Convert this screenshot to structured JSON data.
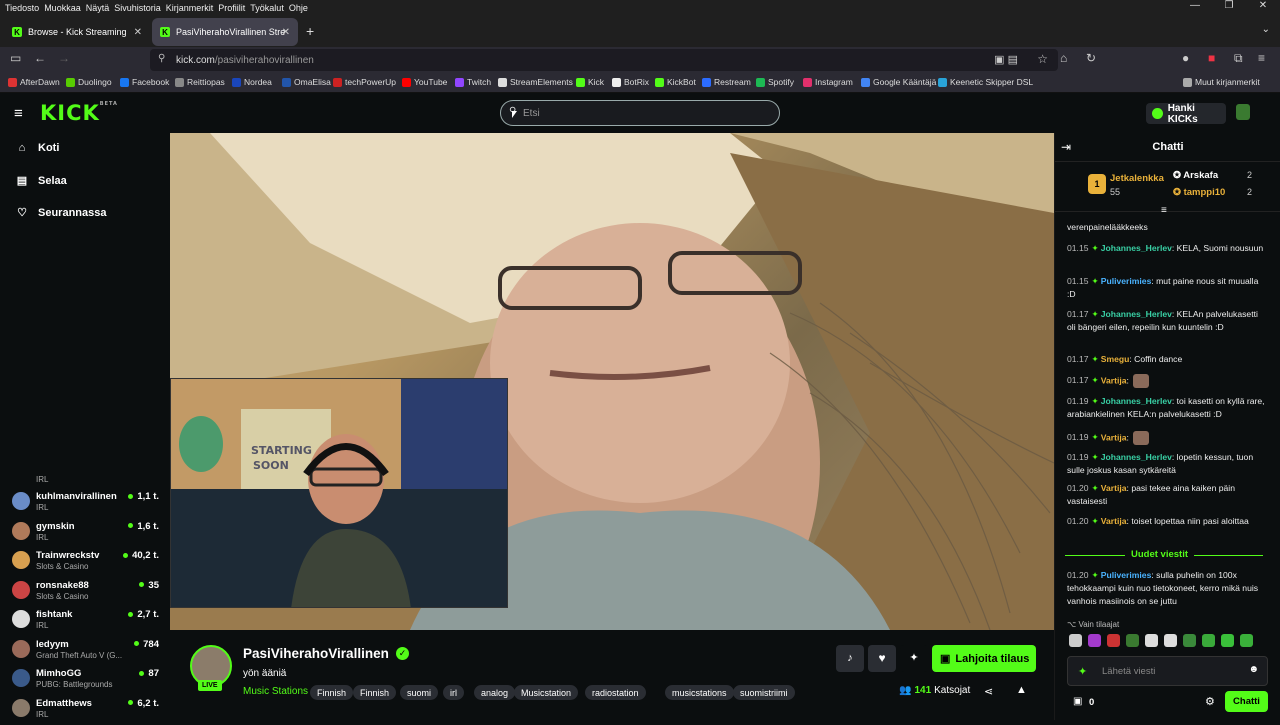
{
  "menubar": {
    "items": [
      "Tiedosto",
      "Muokkaa",
      "Näytä",
      "Sivuhistoria",
      "Kirjanmerkit",
      "Profiilit",
      "Työkalut",
      "Ohje"
    ]
  },
  "tabs": [
    {
      "label": "Browse - Kick Streaming",
      "active": false
    },
    {
      "label": "PasiViherahoVirallinen Stre",
      "active": true
    }
  ],
  "url": {
    "host": "kick.com",
    "path": "/pasiviherahovirallinen"
  },
  "bookmarks": [
    {
      "label": "AfterDawn",
      "color": "#d33"
    },
    {
      "label": "Duolingo",
      "color": "#58cc02"
    },
    {
      "label": "Facebook",
      "color": "#1877f2"
    },
    {
      "label": "Reittiopas",
      "color": "#888"
    },
    {
      "label": "Nordea",
      "color": "#1a46bb"
    },
    {
      "label": "OmaElisa",
      "color": "#2255aa"
    },
    {
      "label": "techPowerUp",
      "color": "#c22"
    },
    {
      "label": "YouTube",
      "color": "#f00"
    },
    {
      "label": "Twitch",
      "color": "#9146ff"
    },
    {
      "label": "StreamElements",
      "color": "#ddd"
    },
    {
      "label": "Kick",
      "color": "#53fc18"
    },
    {
      "label": "BotRix",
      "color": "#eee"
    },
    {
      "label": "KickBot",
      "color": "#53fc18"
    },
    {
      "label": "Restream",
      "color": "#2c6cff"
    },
    {
      "label": "Spotify",
      "color": "#1db954"
    },
    {
      "label": "Instagram",
      "color": "#e1306c"
    },
    {
      "label": "Google Kääntäjä",
      "color": "#4285f4"
    },
    {
      "label": "Keenetic Skipper DSL",
      "color": "#29a3d8"
    },
    {
      "label": "Muut kirjanmerkit",
      "color": "#aaa"
    }
  ],
  "header": {
    "logo": "KICK",
    "logo_badge": "BETA",
    "search_placeholder": "Etsi",
    "kicks_button": "Hanki KICKs"
  },
  "sidenav": {
    "items": [
      {
        "label": "Koti",
        "icon": "home-icon"
      },
      {
        "label": "Selaa",
        "icon": "browse-icon"
      },
      {
        "label": "Seurannassa",
        "icon": "heart-icon"
      }
    ],
    "partial_category": "IRL",
    "channels": [
      {
        "name": "kuhlmanvirallinen",
        "category": "IRL",
        "viewers": "1,1 t."
      },
      {
        "name": "gymskin",
        "category": "IRL",
        "viewers": "1,6 t."
      },
      {
        "name": "Trainwreckstv",
        "category": "Slots & Casino",
        "viewers": "40,2 t."
      },
      {
        "name": "ronsnake88",
        "category": "Slots & Casino",
        "viewers": "35"
      },
      {
        "name": "fishtank",
        "category": "IRL",
        "viewers": "2,7 t."
      },
      {
        "name": "ledyym",
        "category": "Grand Theft Auto V (G...",
        "viewers": "784"
      },
      {
        "name": "MimhoGG",
        "category": "PUBG: Battlegrounds",
        "viewers": "87"
      },
      {
        "name": "Edmatthews",
        "category": "IRL",
        "viewers": "6,2 t."
      }
    ]
  },
  "stream": {
    "channel": "PasiViherahoVirallinen",
    "title": "yön ääniä",
    "category": "Music Stations",
    "live_badge": "LIVE",
    "tags": [
      "Finnish",
      "Finnish",
      "suomi",
      "irl",
      "analog",
      "Musicstation",
      "radiostation",
      "musicstations",
      "suomistriimi"
    ],
    "subscribe_button": "Lahjoita tilaus",
    "viewers": "141",
    "viewers_label": "Katsojat"
  },
  "chat": {
    "title": "Chatti",
    "leaderboard": {
      "first": {
        "name": "Jetkalenkka",
        "score": "55",
        "rank": "1"
      },
      "others": [
        {
          "name": "Arskafa",
          "score": "2"
        },
        {
          "name": "tamppi10",
          "score": "2"
        }
      ]
    },
    "partial_message": "verenpainelääkkeeks",
    "messages": [
      {
        "time": "01.15",
        "user": "Johannes_Herlev",
        "color": "#39d0a5",
        "text": "KELA, Suomi nousuun"
      },
      {
        "time": "01.15",
        "user": "Puliverimies",
        "color": "#4ab3ff",
        "text": "mut paine nous sit muualla :D"
      },
      {
        "time": "01.17",
        "user": "Johannes_Herlev",
        "color": "#39d0a5",
        "text": "KELAn palvelukasetti oli bängeri eilen, repeilin kun kuuntelin :D"
      },
      {
        "time": "01.17",
        "user": "Smegu",
        "color": "#e9b13a",
        "text": "Coffin dance"
      },
      {
        "time": "01.17",
        "user": "Vartija",
        "color": "#e9b13a",
        "text": ""
      },
      {
        "time": "01.19",
        "user": "Johannes_Herlev",
        "color": "#39d0a5",
        "text": "toi kasetti on kyllä rare, arabiankielinen KELA:n palvelukasetti :D"
      },
      {
        "time": "01.19",
        "user": "Vartija",
        "color": "#e9b13a",
        "text": ""
      },
      {
        "time": "01.19",
        "user": "Johannes_Herlev",
        "color": "#39d0a5",
        "text": "lopetin kessun, tuon sulle joskus kasan sytkäreitä"
      },
      {
        "time": "01.20",
        "user": "Vartija",
        "color": "#e9b13a",
        "text": "pasi tekee aina kaiken päin vastaisesti"
      },
      {
        "time": "01.20",
        "user": "Vartija",
        "color": "#e9b13a",
        "text": "toiset lopettaa niin pasi aloittaa"
      }
    ],
    "new_messages_label": "Uudet viestit",
    "new_messages": [
      {
        "time": "01.20",
        "user": "Puliverimies",
        "color": "#4ab3ff",
        "text": "sulla puhelin on 100x tehokkaampi kuin nuo tietokoneet, kerro mikä nuis vanhois masiinois on se juttu"
      }
    ],
    "subscribers_only": "Vain tilaajat",
    "input_placeholder": "Lähetä viesti",
    "points": "0",
    "send_button": "Chatti"
  },
  "colors": {
    "accent": "#53fc18",
    "background": "#0b0e0f",
    "panel": "#191b1f"
  }
}
